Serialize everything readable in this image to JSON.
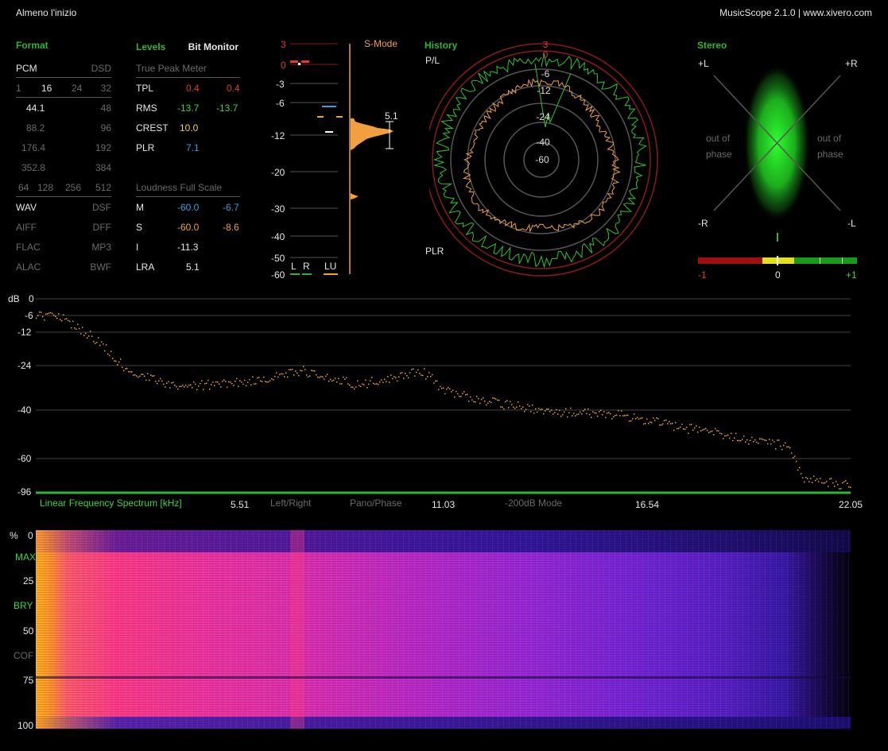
{
  "window": {
    "title": "Almeno l'inizio",
    "app": "MusicScope 2.1.0 | www.xivero.com"
  },
  "format": {
    "header": "Format",
    "pcm_label": "PCM",
    "dsd_label": "DSD",
    "bits": [
      "1",
      "16",
      "24",
      "32"
    ],
    "rates": [
      [
        "44.1",
        "48"
      ],
      [
        "88.2",
        "96"
      ],
      [
        "176.4",
        "192"
      ],
      [
        "352.8",
        "384"
      ]
    ],
    "dsd_rates": [
      "64",
      "128",
      "256",
      "512"
    ],
    "containers": [
      [
        "WAV",
        "DSF"
      ],
      [
        "AIFF",
        "DFF"
      ],
      [
        "FLAC",
        "MP3"
      ],
      [
        "ALAC",
        "BWF"
      ]
    ]
  },
  "levels": {
    "header": "Levels",
    "bit_monitor": "Bit Monitor",
    "tpm_title": "True Peak Meter",
    "tpm_rows": [
      {
        "label": "TPL",
        "l": "0.4",
        "r": "0.4"
      },
      {
        "label": "RMS",
        "l": "-13.7",
        "r": "-13.7"
      },
      {
        "label": "CREST",
        "l": "10.0",
        "r": ""
      },
      {
        "label": "PLR",
        "l": "7.1",
        "r": ""
      }
    ],
    "lfs_title": "Loudness Full Scale",
    "lfs_rows": [
      {
        "label": "M",
        "l": "-60.0",
        "r": "-6.7"
      },
      {
        "label": "S",
        "l": "-60.0",
        "r": "-8.6"
      },
      {
        "label": "I",
        "l": "-11.3",
        "r": ""
      },
      {
        "label": "LRA",
        "l": "5.1",
        "r": ""
      }
    ]
  },
  "meter": {
    "smode": "S-Mode",
    "scale": [
      "3",
      "0",
      "-3",
      "-6",
      "-12",
      "-20",
      "-30",
      "-40",
      "-50",
      "-60"
    ],
    "lra_value": "5.1",
    "channels": [
      "L",
      "R",
      "LU"
    ]
  },
  "history": {
    "header": "History",
    "pl_label": "P/L",
    "plr_label": "PLR",
    "rings": [
      "3",
      "0",
      "-6",
      "-12",
      "-24",
      "-40",
      "-60"
    ]
  },
  "stereo": {
    "header": "Stereo",
    "tl": "+L",
    "tr": "+R",
    "bl": "-R",
    "br": "-L",
    "oop_left": "out of\nphase",
    "oop_right": "out of\nphase",
    "corr_labels": [
      "-1",
      "0",
      "+1"
    ]
  },
  "spectrum": {
    "y_labels": [
      "dB",
      "0",
      "-6",
      "-12",
      "-24",
      "-40",
      "-60",
      "-96"
    ],
    "x_title": "Linear Frequency Spectrum [kHz]",
    "x_ticks": [
      "5.51",
      "11.03",
      "16.54",
      "22.05"
    ],
    "modes": [
      "Left/Right",
      "Pano/Phase",
      "-200dB Mode"
    ]
  },
  "spectrogram": {
    "y_labels": [
      "%",
      "0",
      "MAX",
      "25",
      "BRY",
      "50",
      "COF",
      "75",
      "100"
    ]
  },
  "colors": {
    "accent": "#2fb52f",
    "red": "#e23a2a",
    "orange": "#f0a040",
    "blue": "#3aa0e0"
  }
}
